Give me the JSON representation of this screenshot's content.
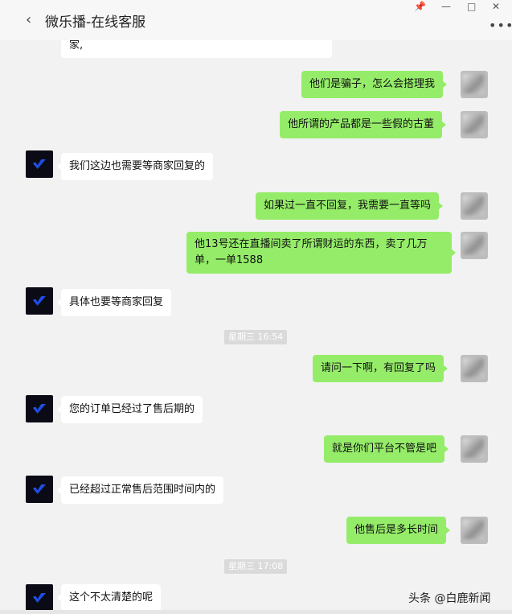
{
  "window": {
    "back_icon": "chevron-left-icon",
    "title": "微乐播-在线客服",
    "controls": [
      "pin-icon",
      "minimize-icon",
      "maximize-icon",
      "close-icon",
      "more-icon"
    ]
  },
  "messages": [
    {
      "side": "in",
      "text": "家,"
    },
    {
      "side": "out",
      "text": "他们是骗子，怎么会搭理我"
    },
    {
      "side": "out",
      "text": "他所谓的产品都是一些假的古董"
    },
    {
      "side": "in",
      "text": "我们这边也需要等商家回复的"
    },
    {
      "side": "out",
      "text": "如果过一直不回复，我需要一直等吗"
    },
    {
      "side": "out",
      "text": "他13号还在直播间卖了所谓财运的东西，卖了几万单，一单1588"
    },
    {
      "side": "in",
      "text": "具体也要等商家回复"
    },
    {
      "timestamp": "星期三 16:54"
    },
    {
      "side": "out",
      "text": "请问一下啊，有回复了吗"
    },
    {
      "side": "in",
      "text": "您的订单已经过了售后期的"
    },
    {
      "side": "out",
      "text": "就是你们平台不管是吧"
    },
    {
      "side": "in",
      "text": "已经超过正常售后范围时间内的"
    },
    {
      "side": "out",
      "text": "他售后是多长时间"
    },
    {
      "timestamp": "星期三 17:08"
    },
    {
      "side": "in",
      "text": "这个不太清楚的呢"
    }
  ],
  "watermark": "头条 @白鹿新闻"
}
